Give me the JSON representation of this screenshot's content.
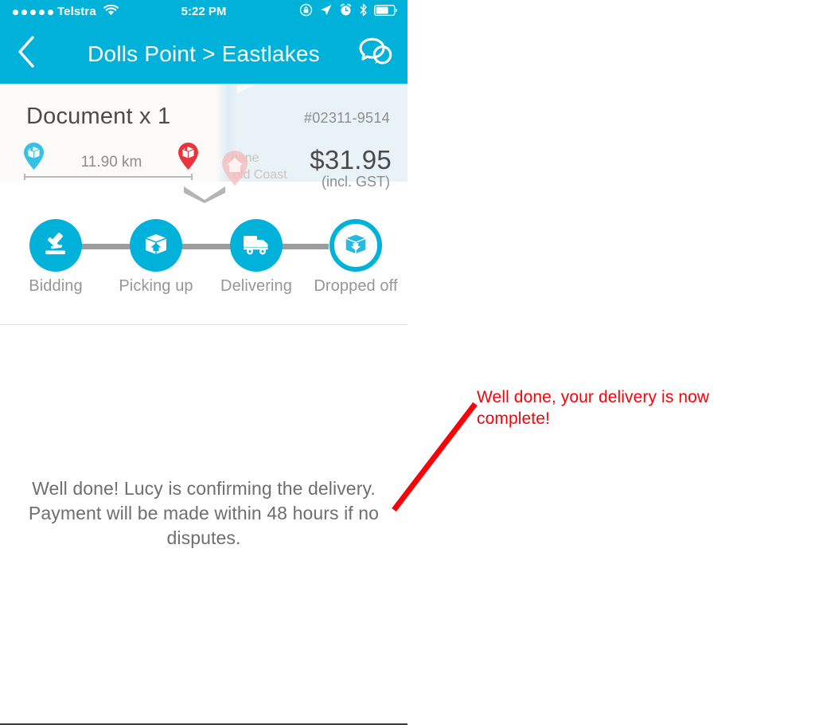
{
  "screen": {
    "status_bar": {
      "signal_dots": 5,
      "carrier": "Telstra",
      "wifi_icon": "wifi-icon",
      "time": "5:22 PM",
      "right_icons": [
        "rotation-lock-icon",
        "location-arrow-icon",
        "alarm-clock-icon",
        "bluetooth-icon",
        "battery-icon"
      ]
    },
    "nav_bar": {
      "back_icon": "chevron-left-icon",
      "title": "Dolls Point > Eastlakes",
      "chat_icon": "chat-bubbles-icon"
    },
    "job_card": {
      "title": "Document x 1",
      "reference": "#02311-9514",
      "price": "$31.95",
      "price_note": "(incl. GST)",
      "distance": "11.90 km",
      "pickup_pin_icon": "pickup-package-pin-icon",
      "dropoff_pin_icon": "dropoff-package-pin-icon",
      "expand_icon": "chevron-down-icon",
      "map_labels": [
        "bane",
        "old Coast"
      ],
      "map_home_pin_icon": "home-pin-icon"
    },
    "tracker": {
      "steps": [
        {
          "label": "Bidding",
          "icon": "gavel-icon",
          "state": "done"
        },
        {
          "label": "Picking up",
          "icon": "box-up-arrow-icon",
          "state": "done"
        },
        {
          "label": "Delivering",
          "icon": "delivery-truck-icon",
          "state": "done"
        },
        {
          "label": "Dropped off",
          "icon": "box-down-arrow-icon",
          "state": "active"
        }
      ]
    },
    "message": "Well done! Lucy is confirming the delivery. Payment will be made within 48 hours if no disputes."
  },
  "annotation": {
    "text": "Well done, your delivery is now complete!",
    "color": "#fb0007",
    "pointer_icon": "callout-line"
  },
  "colors": {
    "brand_teal": "#00b2da",
    "annotation_red": "#fb0007",
    "text_gray": "#6e6e6e",
    "muted_gray": "#969696",
    "pin_red": "#e9343c"
  }
}
